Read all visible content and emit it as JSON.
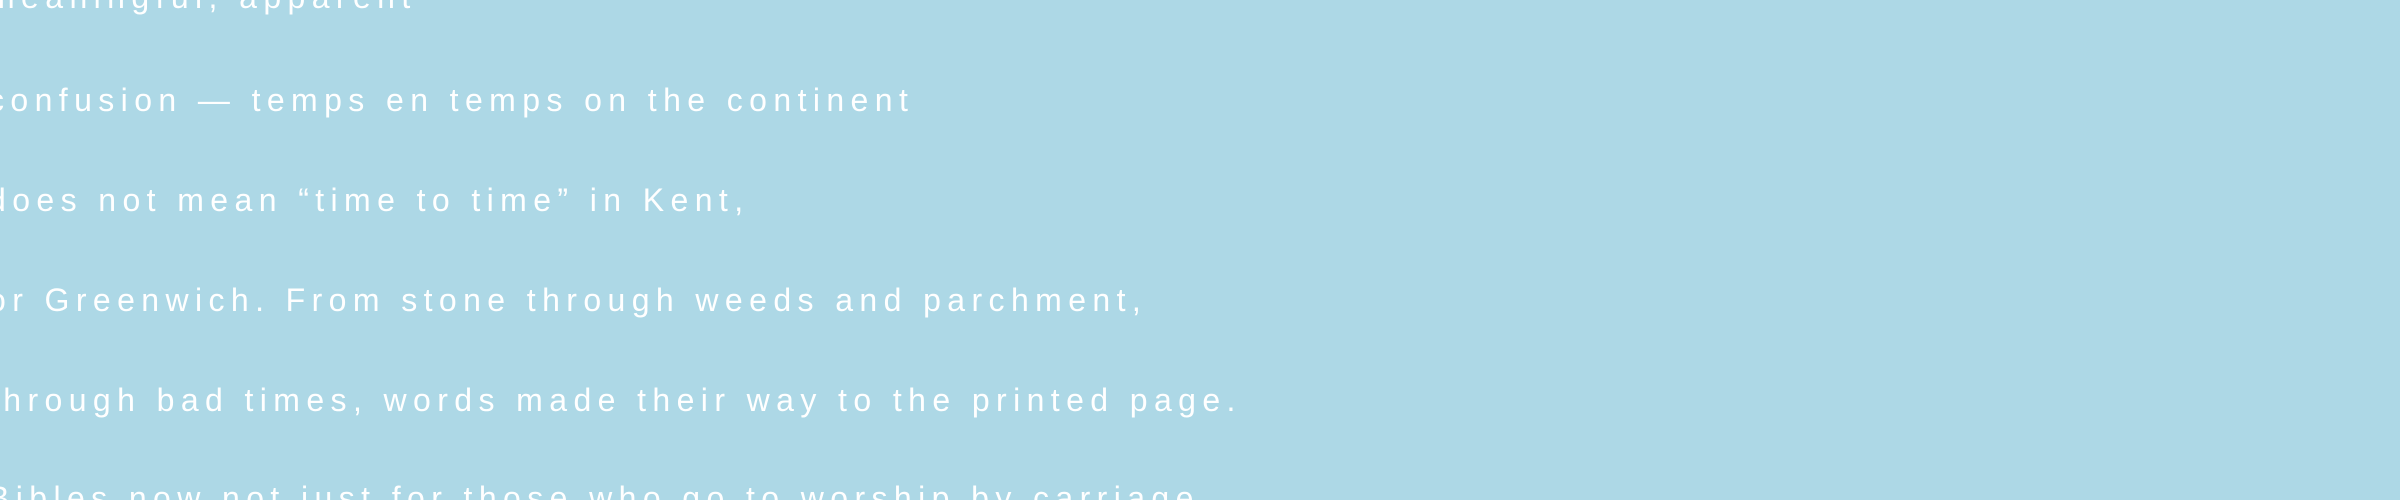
{
  "background_color": "#add8e6",
  "text_color": "#ffffff",
  "lines": [
    "meaningful, apparent",
    "confusion — temps en temps on the continent",
    "does not mean “time to time” in Kent,",
    "or Greenwich. From stone through weeds and parchment,",
    "through bad times, words made their way to the printed page.",
    "Bibles now not just for those who go to worship by carriage"
  ]
}
